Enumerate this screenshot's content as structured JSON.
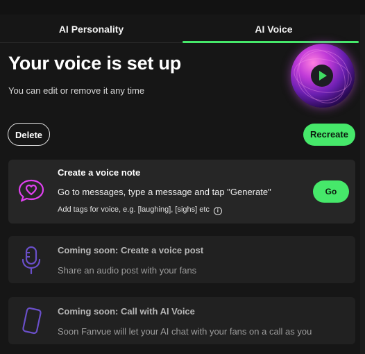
{
  "tabs": [
    {
      "label": "AI Personality",
      "active": false
    },
    {
      "label": "AI Voice",
      "active": true
    }
  ],
  "hero": {
    "title": "Your voice is set up",
    "subtitle": "You can edit or remove it any time"
  },
  "actions": {
    "delete_label": "Delete",
    "recreate_label": "Recreate"
  },
  "cards": [
    {
      "icon": "heart-chat-icon",
      "title": "Create a voice note",
      "description": "Go to messages, type a message and tap \"Generate\"",
      "note": "Add tags for voice, e.g. [laughing], [sighs] etc",
      "button_label": "Go"
    },
    {
      "icon": "microphone-icon",
      "title": "Coming soon: Create a voice post",
      "description": "Share an audio post with your fans"
    },
    {
      "icon": "phone-icon",
      "title": "Coming soon: Call with AI Voice",
      "description": "Soon Fanvue will let your AI chat with your fans on a call as you"
    }
  ],
  "colors": {
    "accent": "#46e86a",
    "icon_active": "#e040f0",
    "icon_muted": "#6a4fc9",
    "background": "#161616",
    "card": "#262626"
  }
}
